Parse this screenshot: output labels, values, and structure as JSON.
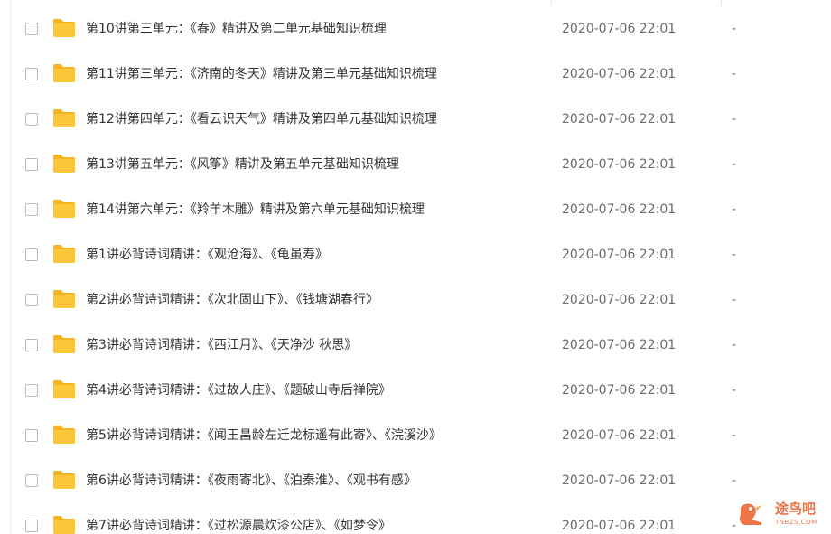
{
  "files": [
    {
      "name": "第10讲第三单元：《春》精讲及第二单元基础知识梳理",
      "modified": "2020-07-06 22:01",
      "size": "-"
    },
    {
      "name": "第11讲第三单元：《济南的冬天》精讲及第三单元基础知识梳理",
      "modified": "2020-07-06 22:01",
      "size": "-"
    },
    {
      "name": "第12讲第四单元：《看云识天气》精讲及第四单元基础知识梳理",
      "modified": "2020-07-06 22:01",
      "size": "-"
    },
    {
      "name": "第13讲第五单元：《风筝》精讲及第五单元基础知识梳理",
      "modified": "2020-07-06 22:01",
      "size": "-"
    },
    {
      "name": "第14讲第六单元：《羚羊木雕》精讲及第六单元基础知识梳理",
      "modified": "2020-07-06 22:01",
      "size": "-"
    },
    {
      "name": "第1讲必背诗词精讲：《观沧海》、《龟虽寿》",
      "modified": "2020-07-06 22:01",
      "size": "-"
    },
    {
      "name": "第2讲必背诗词精讲：《次北固山下》、《钱塘湖春行》",
      "modified": "2020-07-06 22:01",
      "size": "-"
    },
    {
      "name": "第3讲必背诗词精讲：《西江月》、《天净沙 秋思》",
      "modified": "2020-07-06 22:01",
      "size": "-"
    },
    {
      "name": "第4讲必背诗词精讲：《过故人庄》、《题破山寺后禅院》",
      "modified": "2020-07-06 22:01",
      "size": "-"
    },
    {
      "name": "第5讲必背诗词精讲：《闻王昌龄左迁龙标遥有此寄》、《浣溪沙》",
      "modified": "2020-07-06 22:01",
      "size": "-"
    },
    {
      "name": "第6讲必背诗词精讲：《夜雨寄北》、《泊秦淮》、《观书有感》",
      "modified": "2020-07-06 22:01",
      "size": "-"
    },
    {
      "name": "第7讲必背诗词精讲：《过松源晨炊漆公店》、《如梦令》",
      "modified": "2020-07-06 22:01",
      "size": "-"
    }
  ],
  "watermark": {
    "text": "途鸟吧",
    "sub": "TNBZS.COM"
  },
  "colors": {
    "folder": "#fcc63a",
    "folder_tab": "#f5b520",
    "text": "#333333",
    "meta": "#6b6b6b",
    "watermark": "#e85c2a"
  }
}
